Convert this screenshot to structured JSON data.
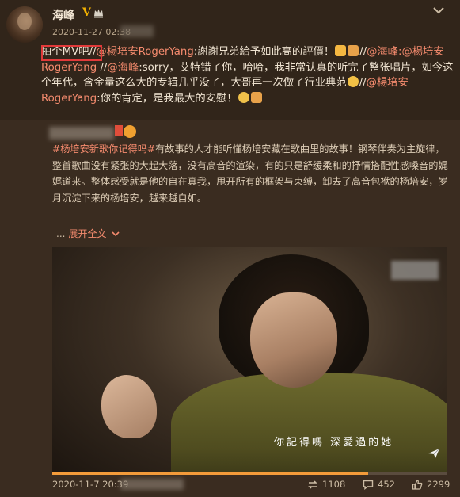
{
  "post": {
    "username": "海峰",
    "verified_badge": "V",
    "time": "2020-11-27 02:38",
    "text_parts": [
      {
        "t": "拍个MV吧//",
        "c": "normal"
      },
      {
        "t": "@楊培安RogerYang",
        "c": "at"
      },
      {
        "t": ":謝謝兄弟給予如此高的評價！",
        "c": "normal"
      },
      {
        "t": "",
        "c": "emoji-ok"
      },
      {
        "t": "",
        "c": "emoji-shake"
      },
      {
        "t": "//",
        "c": "normal"
      },
      {
        "t": "@海峰",
        "c": "at"
      },
      {
        "t": ":@楊培安RogerYang",
        "c": "at"
      },
      {
        "t": " //",
        "c": "normal"
      },
      {
        "t": "@海峰",
        "c": "at"
      },
      {
        "t": ":sorry，艾特错了你，哈哈，我非常认真的听完了整张唱片，如今这个年代，含金量这么大的专辑几乎没了，大哥再一次做了行业典范",
        "c": "normal"
      },
      {
        "t": "",
        "c": "emoji-face"
      },
      {
        "t": "//",
        "c": "normal"
      },
      {
        "t": "@楊培安RogerYang",
        "c": "at"
      },
      {
        "t": ":你的肯定，是我最大的安慰！",
        "c": "normal"
      },
      {
        "t": "",
        "c": "emoji-heart"
      },
      {
        "t": "",
        "c": "emoji-shake"
      }
    ]
  },
  "repost": {
    "hashtag": "#杨培安新歌你记得吗#",
    "body": "有故事的人才能听懂杨培安藏在歌曲里的故事！钢琴伴奏为主旋律，整首歌曲没有紧张的大起大落，没有高音的渲染，有的只是舒缓柔和的抒情搭配性感嗓音的娓娓道来。整体感受就是他的自在真我，甩开所有的框架与束缚，卸去了高音包袱的杨培安，岁月沉淀下来的杨培安，越来越自如。",
    "expand_dots": "...",
    "expand_label": "展开全文",
    "expand_icon": "chevron-down-icon",
    "video_subtitle": "你記得嗎  深愛過的她",
    "video_progress": 0.8,
    "footer": {
      "time": "2020-11-7 20:39",
      "repost_count": "1108",
      "comment_count": "452",
      "like_count": "2299"
    }
  },
  "colors": {
    "background": "#312418",
    "mention": "#f58b6e",
    "highlight_box": "#e23a3a",
    "progress": "#f39b3a"
  }
}
